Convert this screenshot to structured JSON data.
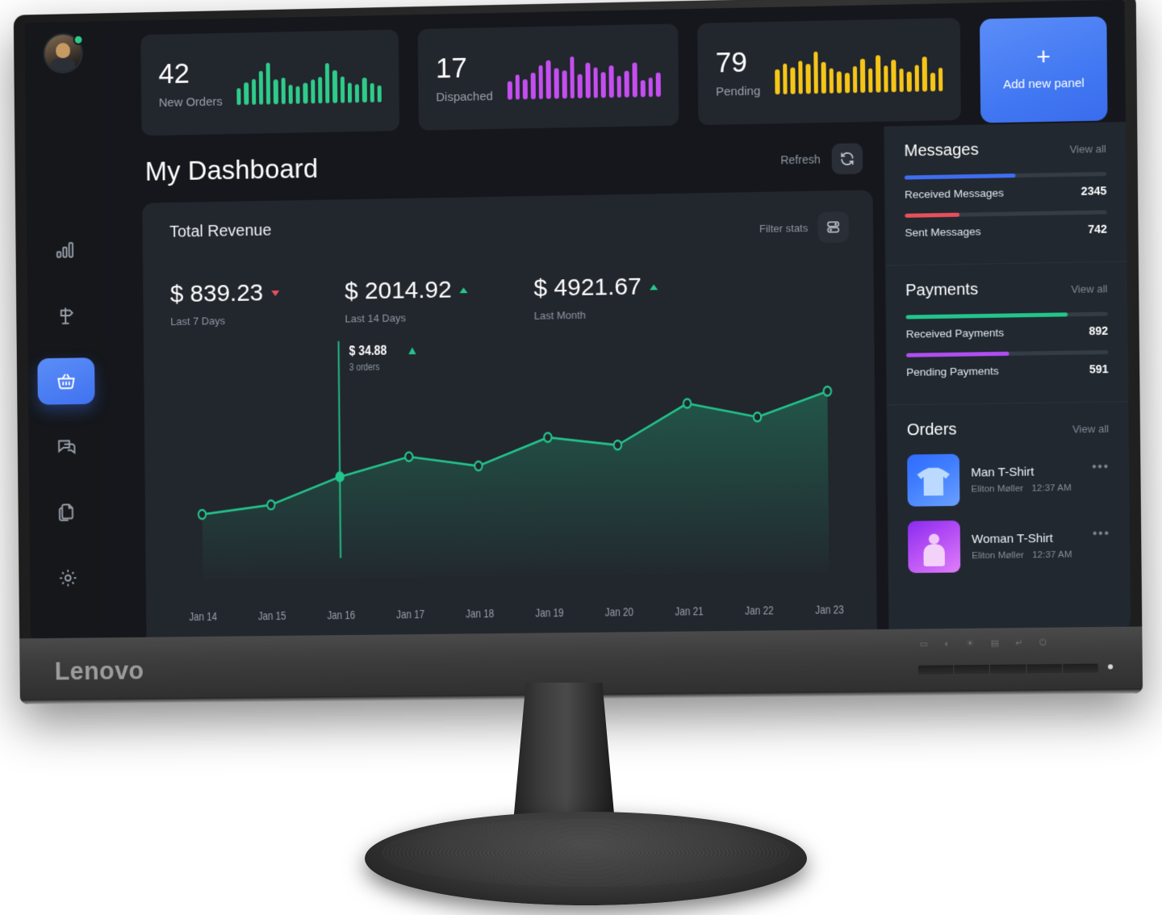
{
  "hardware": {
    "brand": "Lenovo",
    "osd_icons": [
      "input-icon",
      "contrast-icon",
      "brightness-icon",
      "menu-icon",
      "exit-icon",
      "power-icon"
    ]
  },
  "sidebar": {
    "avatar": {
      "name": "user-avatar",
      "status": "online"
    },
    "items": [
      {
        "icon": "bar-chart-icon",
        "name": "analytics",
        "active": false
      },
      {
        "icon": "signpost-icon",
        "name": "campaigns",
        "active": false
      },
      {
        "icon": "basket-icon",
        "name": "orders",
        "active": true
      },
      {
        "icon": "chat-icon",
        "name": "messages",
        "active": false
      },
      {
        "icon": "documents-icon",
        "name": "documents",
        "active": false
      },
      {
        "icon": "gear-icon",
        "name": "settings",
        "active": false
      }
    ]
  },
  "stats": [
    {
      "value": "42",
      "label": "New Orders",
      "color": "#2ecc8a",
      "spark": [
        38,
        52,
        60,
        78,
        96,
        58,
        62,
        45,
        40,
        48,
        56,
        62,
        92,
        76,
        62,
        46,
        42,
        58,
        44,
        38
      ]
    },
    {
      "value": "17",
      "label": "Dispached",
      "color": "#c44ef0",
      "spark": [
        42,
        58,
        46,
        62,
        78,
        88,
        70,
        64,
        96,
        56,
        82,
        70,
        60,
        74,
        50,
        62,
        80,
        38,
        44,
        56
      ]
    },
    {
      "value": "79",
      "label": "Pending",
      "color": "#f5c518",
      "spark": [
        58,
        70,
        62,
        76,
        68,
        96,
        72,
        58,
        50,
        46,
        62,
        78,
        56,
        86,
        62,
        74,
        54,
        46,
        62,
        80,
        42,
        54
      ]
    }
  ],
  "add_panel": {
    "plus": "+",
    "label": "Add new panel"
  },
  "header": {
    "title": "My Dashboard",
    "refresh_label": "Refresh",
    "refresh_icon": "refresh-icon"
  },
  "revenue": {
    "title": "Total Revenue",
    "filter_label": "Filter stats",
    "filter_icon": "filter-toggles-icon",
    "metrics": [
      {
        "value": "$ 839.23",
        "sub": "Last 7 Days",
        "trend": "down"
      },
      {
        "value": "$ 2014.92",
        "sub": "Last 14 Days",
        "trend": "up"
      },
      {
        "value": "$ 4921.67",
        "sub": "Last Month",
        "trend": "up"
      }
    ]
  },
  "chart_data": {
    "type": "line",
    "title": "Total Revenue",
    "xlabel": "",
    "ylabel": "",
    "grid": false,
    "legend": "none",
    "line_color": "#22c58b",
    "categories": [
      "Jan 14",
      "Jan 15",
      "Jan 16",
      "Jan 17",
      "Jan 18",
      "Jan 19",
      "Jan 20",
      "Jan 21",
      "Jan 22",
      "Jan 23"
    ],
    "values": [
      22.5,
      25.5,
      34.88,
      41.5,
      38.0,
      47.5,
      44.5,
      58.5,
      53.5,
      62.0
    ],
    "ylim": [
      0,
      70
    ],
    "highlight": {
      "index": 2,
      "category": "Jan 16",
      "value_label": "$ 34.88",
      "orders_label": "3 orders",
      "trend": "up"
    }
  },
  "rail": {
    "messages": {
      "title": "Messages",
      "view_all": "View all",
      "bars": [
        {
          "name": "Received Messages",
          "value": "2345",
          "pct": 55,
          "color": "#3f6ef0"
        },
        {
          "name": "Sent Messages",
          "value": "742",
          "pct": 27,
          "color": "#e8505b"
        }
      ]
    },
    "payments": {
      "title": "Payments",
      "view_all": "View all",
      "bars": [
        {
          "name": "Received Payments",
          "value": "892",
          "pct": 80,
          "color": "#22c58b"
        },
        {
          "name": "Pending Payments",
          "value": "591",
          "pct": 51,
          "color": "#b04ef0"
        }
      ]
    },
    "orders": {
      "title": "Orders",
      "view_all": "View all",
      "items": [
        {
          "name": "Man T-Shirt",
          "buyer": "Eliton Møller",
          "time": "12:37 AM",
          "thumb": "thumb-blue",
          "more": "•••"
        },
        {
          "name": "Woman T-Shirt",
          "buyer": "Eliton Møller",
          "time": "12:37 AM",
          "thumb": "thumb-purple",
          "more": "•••"
        }
      ]
    }
  }
}
